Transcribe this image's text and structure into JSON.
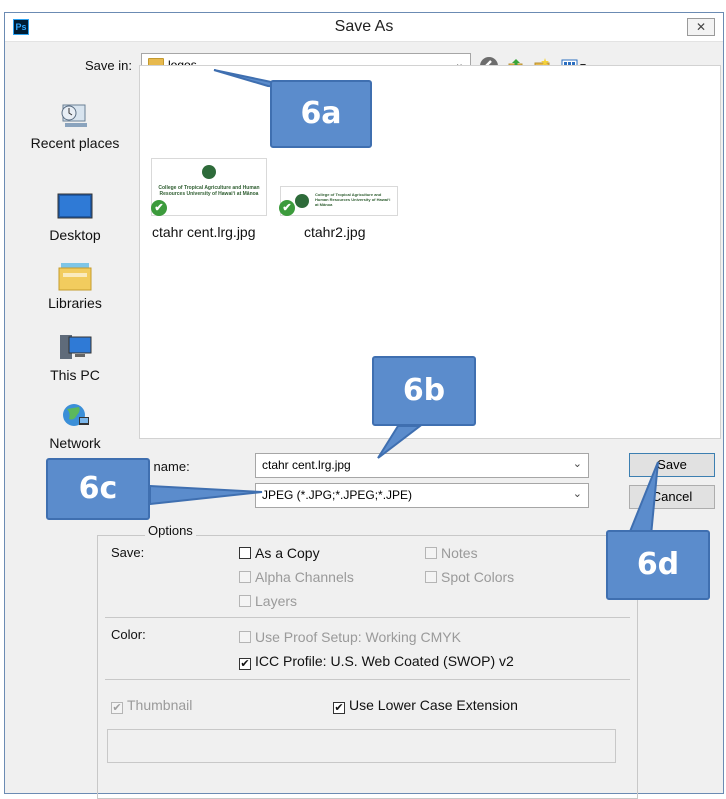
{
  "window": {
    "title": "Save As",
    "app_icon": "Ps",
    "close_glyph": "✕"
  },
  "save_in": {
    "label": "Save in:",
    "value": "logos",
    "arrow": "⌄"
  },
  "toolbar": {
    "back": "back-icon",
    "up": "up-folder-icon",
    "new_folder": "new-folder-icon",
    "view_menu": "view-menu-icon"
  },
  "places": [
    {
      "label": "Recent places",
      "icon": "recent-places-icon"
    },
    {
      "label": "Desktop",
      "icon": "desktop-icon"
    },
    {
      "label": "Libraries",
      "icon": "libraries-icon"
    },
    {
      "label": "This PC",
      "icon": "this-pc-icon"
    },
    {
      "label": "Network",
      "icon": "network-icon"
    }
  ],
  "files": [
    {
      "name": "ctahr cent.lrg.jpg",
      "thumb_text": "College of Tropical Agriculture and Human Resources University of Hawaiʻi at Mānoa"
    },
    {
      "name": "ctahr2.jpg",
      "thumb_text": "College of Tropical Agriculture and Human Resources University of Hawaiʻi at Mānoa"
    }
  ],
  "file_name": {
    "label": "File name:",
    "value": "ctahr cent.lrg.jpg",
    "arrow": "⌄"
  },
  "format": {
    "value": "JPEG (*.JPG;*.JPEG;*.JPE)",
    "arrow": "⌄"
  },
  "buttons": {
    "save": "Save",
    "cancel": "Cancel"
  },
  "options": {
    "legend": "Options",
    "save_label": "Save:",
    "as_a_copy": "As a Copy",
    "notes": "Notes",
    "alpha_channels": "Alpha Channels",
    "spot_colors": "Spot Colors",
    "layers": "Layers"
  },
  "color": {
    "label": "Color:",
    "use_proof_setup": "Use Proof Setup:  Working CMYK",
    "icc_profile": "ICC Profile:  U.S. Web Coated (SWOP) v2"
  },
  "bottom": {
    "thumbnail": "Thumbnail",
    "lower_case": "Use Lower Case Extension"
  },
  "checkmark": "✔",
  "callouts": {
    "a": "6a",
    "b": "6b",
    "c": "6c",
    "d": "6d"
  },
  "colors": {
    "callout_fill": "#5b8ccc",
    "callout_border": "#3f6fb0"
  }
}
